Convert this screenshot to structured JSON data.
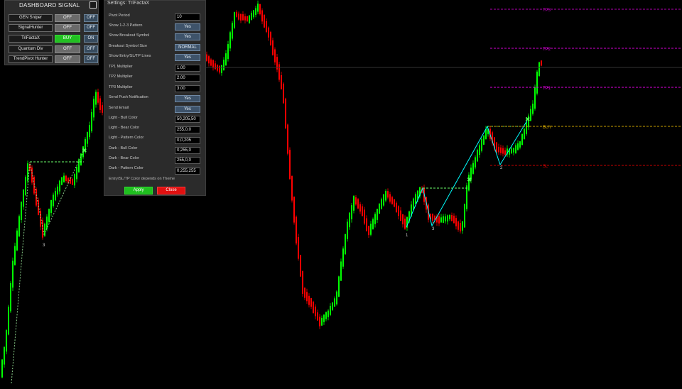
{
  "dashboard": {
    "title": "DASHBOARD SIGNAL",
    "rows": [
      {
        "name": "GEN Sniper",
        "state": "OFF",
        "toggle": "OFF",
        "active": false
      },
      {
        "name": "SignalHunter",
        "state": "OFF",
        "toggle": "OFF",
        "active": false
      },
      {
        "name": "TriFactaX",
        "state": "BUY",
        "toggle": "ON",
        "active": true
      },
      {
        "name": "Quantum Div",
        "state": "OFF",
        "toggle": "OFF",
        "active": false
      },
      {
        "name": "TrendPivot Hunter",
        "state": "OFF",
        "toggle": "OFF",
        "active": false
      }
    ]
  },
  "settings": {
    "title": "Settings: TriFactaX",
    "rows": [
      {
        "label": "Pivot Period",
        "value": "10",
        "kind": "input"
      },
      {
        "label": "Show 1-2-3 Pattern",
        "value": "Yes",
        "kind": "button"
      },
      {
        "label": "Show Breakout Symbol",
        "value": "Yes",
        "kind": "button"
      },
      {
        "label": "Breakout Symbol Size",
        "value": "NORMAL",
        "kind": "button"
      },
      {
        "label": "Show Entry/SL/TP Lines",
        "value": "Yes",
        "kind": "button"
      },
      {
        "label": "TP1 Multiplier",
        "value": "1.00",
        "kind": "input"
      },
      {
        "label": "TP2 Multiplier",
        "value": "2.00",
        "kind": "input"
      },
      {
        "label": "TP3 Multiplier",
        "value": "3.00",
        "kind": "input"
      },
      {
        "label": "Send Push Notification",
        "value": "Yes",
        "kind": "button"
      },
      {
        "label": "Send Email",
        "value": "Yes",
        "kind": "button"
      },
      {
        "label": "Light - Bull Color",
        "value": "50,205,50",
        "kind": "input"
      },
      {
        "label": "Light - Bear Color",
        "value": "255,0,0",
        "kind": "input"
      },
      {
        "label": "Light - Pattern Color",
        "value": "0,0,205",
        "kind": "input"
      },
      {
        "label": "Dark - Bull Color",
        "value": "0,255,0",
        "kind": "input"
      },
      {
        "label": "Dark - Bear Color",
        "value": "255,0,0",
        "kind": "input"
      },
      {
        "label": "Dark - Pattern Color",
        "value": "0,255,255",
        "kind": "input"
      }
    ],
    "note": "Entry/SL/TP Color depends on Theme",
    "apply_label": "Apply",
    "close_label": "Close"
  },
  "chart": {
    "levels": [
      {
        "label": "TP3",
        "color": "#b000b0"
      },
      {
        "label": "TP2",
        "color": "#d000d0"
      },
      {
        "label": "TP1",
        "color": "#e000e0"
      },
      {
        "label": "BUY",
        "color": "#c8a000"
      },
      {
        "label": "SL",
        "color": "#c80000"
      }
    ],
    "point_labels": [
      "3",
      "1",
      "3",
      "2"
    ],
    "colors": {
      "bull": "#00ff00",
      "bear": "#ff0000",
      "pattern": "#00ffff",
      "background": "#000000"
    }
  }
}
